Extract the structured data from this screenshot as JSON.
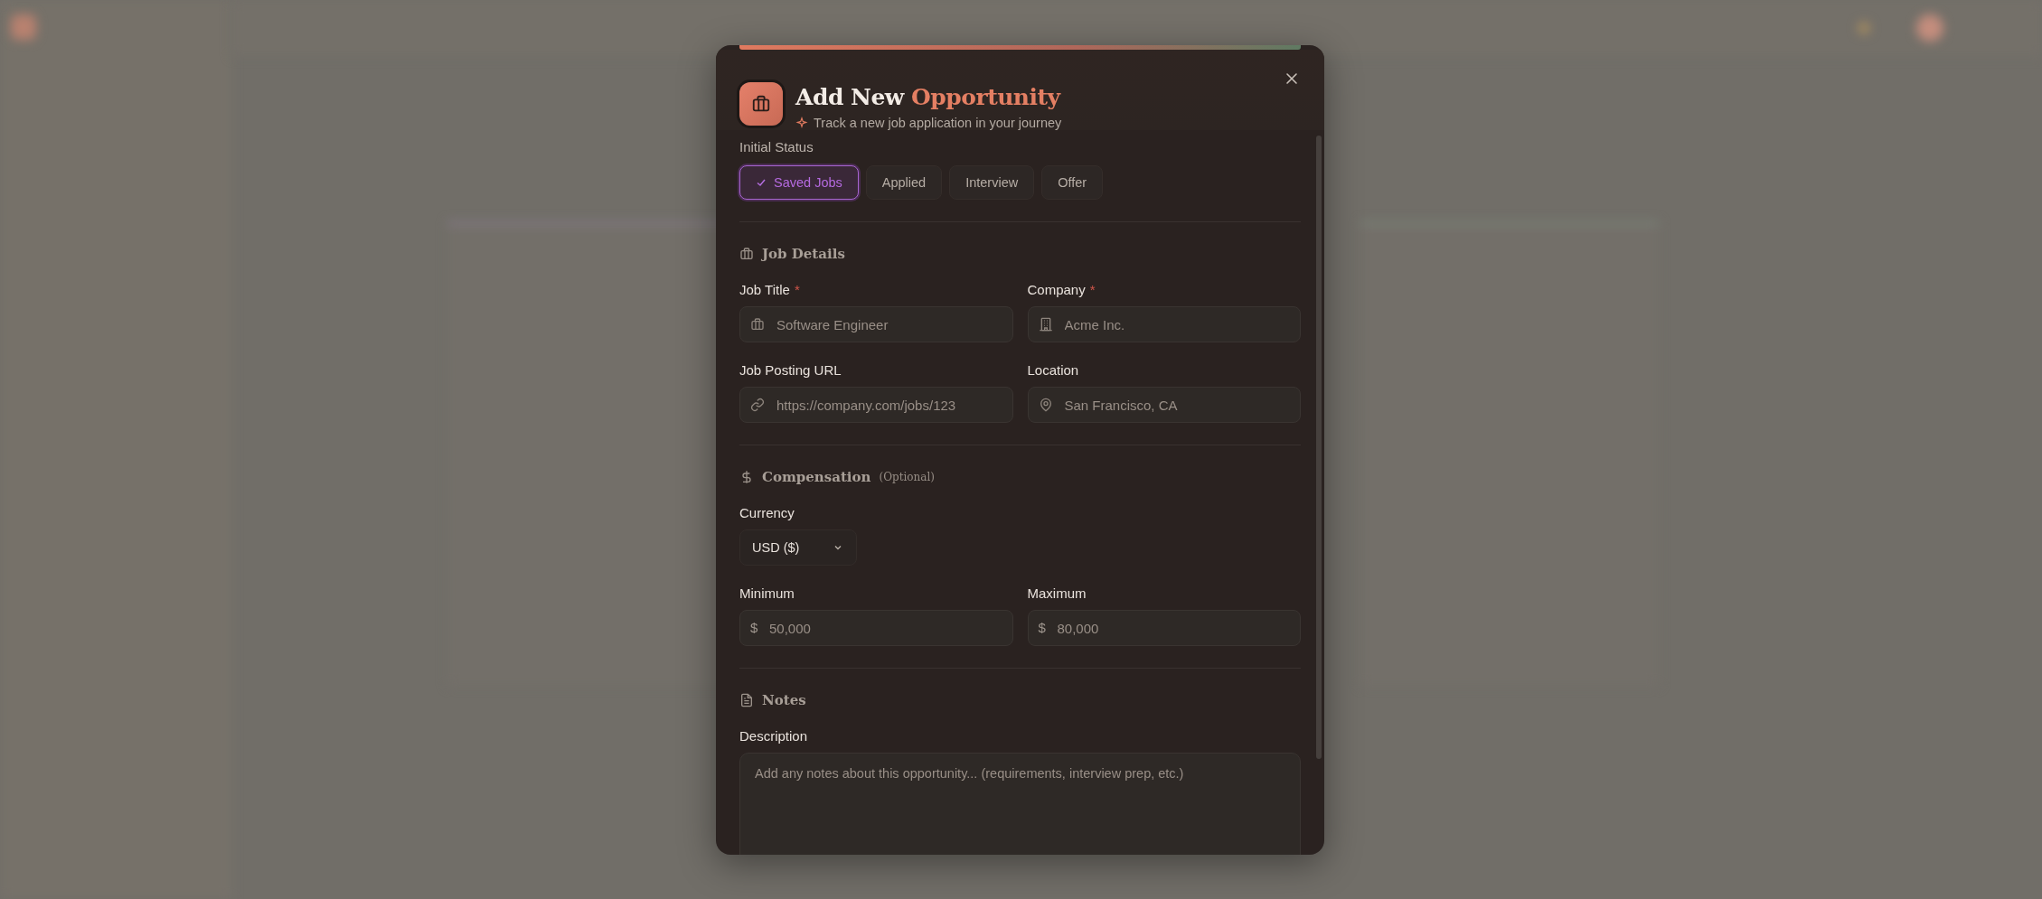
{
  "dialog": {
    "title": "Add New",
    "title_highlight": "Opportunity",
    "subtitle": "Track a new job application in your journey",
    "status_label": "Initial Status",
    "statuses": [
      {
        "label": "Saved Jobs",
        "selected": true
      },
      {
        "label": "Applied",
        "selected": false
      },
      {
        "label": "Interview",
        "selected": false
      },
      {
        "label": "Offer",
        "selected": false
      }
    ],
    "sections": [
      {
        "kind": "details",
        "title": "Job Details",
        "fields": [
          {
            "kind": "text",
            "label": "Job Title",
            "required_mark": "*",
            "placeholder": "Software Engineer"
          },
          {
            "kind": "text",
            "label": "Company",
            "required_mark": "*",
            "placeholder": "Acme Inc."
          },
          {
            "kind": "text",
            "label": "Job Posting URL",
            "placeholder": "https://company.com/jobs/123"
          },
          {
            "kind": "text",
            "label": "Location",
            "placeholder": "San Francisco, CA"
          }
        ]
      },
      {
        "kind": "compensation",
        "title": "Compensation",
        "hint": "(Optional)",
        "fields": [
          {
            "kind": "select",
            "label": "Currency",
            "value": "USD ($)"
          },
          {
            "kind": "money",
            "label": "Minimum",
            "prefix": "$",
            "placeholder": "50,000"
          },
          {
            "kind": "money",
            "label": "Maximum",
            "prefix": "$",
            "placeholder": "80,000"
          }
        ]
      },
      {
        "kind": "notes",
        "title": "Notes",
        "fields": [
          {
            "kind": "textarea",
            "label": "Description",
            "placeholder": "Add any notes about this opportunity... (requirements, interview prep, etc.)"
          }
        ]
      }
    ]
  }
}
